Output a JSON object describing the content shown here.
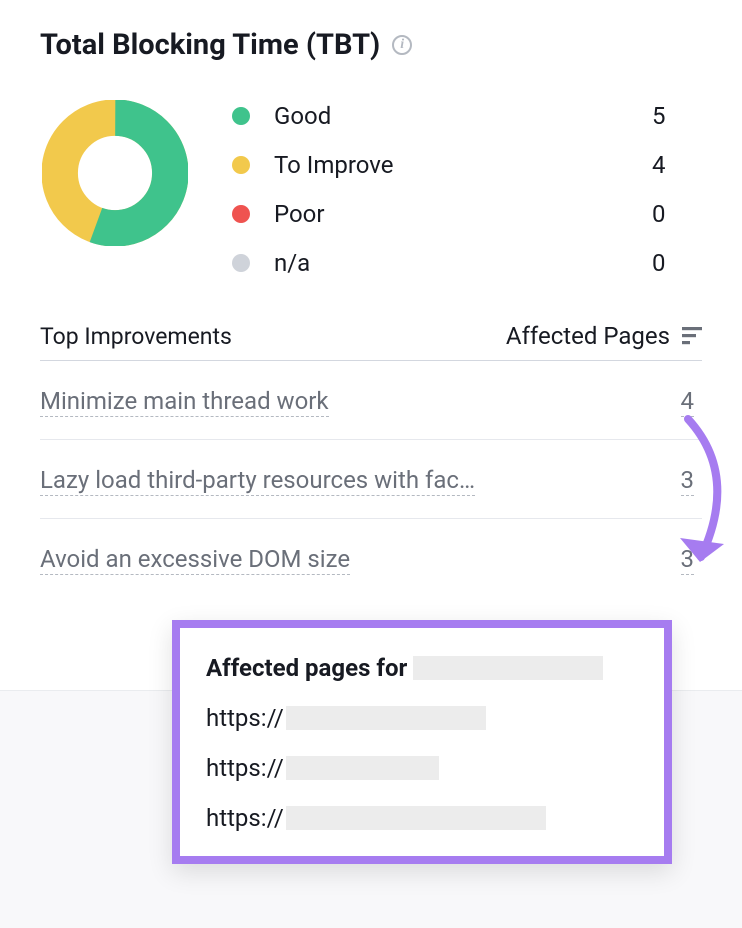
{
  "card": {
    "title": "Total Blocking Time (TBT)"
  },
  "chart_data": {
    "type": "pie",
    "title": "Total Blocking Time (TBT)",
    "categories": [
      "Good",
      "To Improve",
      "Poor",
      "n/a"
    ],
    "values": [
      5,
      4,
      0,
      0
    ],
    "colors": [
      "#3fc38c",
      "#f2c94c",
      "#ef5350",
      "#cfd3da"
    ]
  },
  "legend": [
    {
      "label": "Good",
      "value": "5",
      "color": "#3fc38c"
    },
    {
      "label": "To Improve",
      "value": "4",
      "color": "#f2c94c"
    },
    {
      "label": "Poor",
      "value": "0",
      "color": "#ef5350"
    },
    {
      "label": "n/a",
      "value": "0",
      "color": "#cfd3da"
    }
  ],
  "table": {
    "col1": "Top Improvements",
    "col2": "Affected Pages",
    "rows": [
      {
        "label": "Minimize main thread work",
        "value": "4"
      },
      {
        "label": "Lazy load third-party resources with fac…",
        "value": "3"
      },
      {
        "label": "Avoid an excessive DOM size",
        "value": "3"
      }
    ]
  },
  "tooltip": {
    "title": "Affected pages for",
    "urls": [
      "https://",
      "https://",
      "https://"
    ]
  }
}
